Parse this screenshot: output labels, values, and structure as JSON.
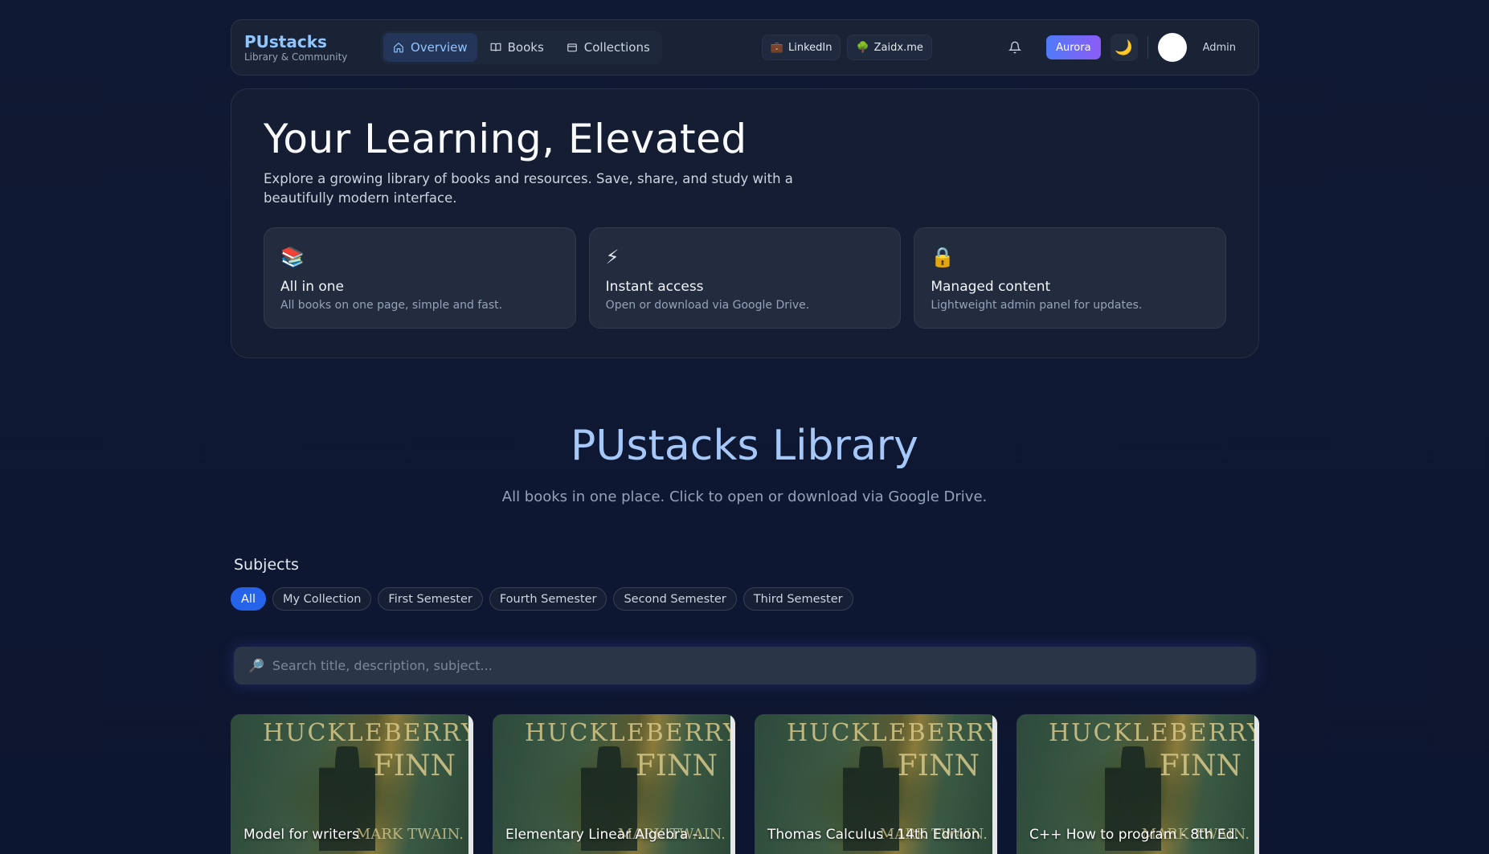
{
  "nav": {
    "brand": "PUstacks",
    "brand_sub": "Library & Community",
    "tabs": [
      {
        "label": "Overview",
        "icon": "home-icon"
      },
      {
        "label": "Books",
        "icon": "book-open-icon"
      },
      {
        "label": "Collections",
        "icon": "archive-icon"
      }
    ],
    "links": [
      {
        "label": "LinkedIn",
        "emoji": "💼"
      },
      {
        "label": "Zaidx.me",
        "emoji": "🌳"
      }
    ],
    "aurora_label": "Aurora",
    "theme_emoji": "🌙",
    "admin_label": "Admin"
  },
  "hero": {
    "title": "Your Learning, Elevated",
    "subtitle": "Explore a growing library of books and resources. Save, share, and study with a beautifully modern interface.",
    "features": [
      {
        "emoji": "📚",
        "title": "All in one",
        "desc": "All books on one page, simple and fast."
      },
      {
        "emoji": "⚡",
        "title": "Instant access",
        "desc": "Open or download via Google Drive."
      },
      {
        "emoji": "🔒",
        "title": "Managed content",
        "desc": "Lightweight admin panel for updates."
      }
    ]
  },
  "library": {
    "title": "PUstacks Library",
    "subtitle": "All books in one place. Click to open or download via Google Drive."
  },
  "subjects": {
    "label": "Subjects",
    "chips": [
      "All",
      "My Collection",
      "First Semester",
      "Fourth Semester",
      "Second Semester",
      "Third Semester"
    ],
    "active": "All"
  },
  "search": {
    "placeholder": "Search title, description, subject..."
  },
  "cover_text": {
    "title": "HUCKLEBERRY",
    "finn": "FINN",
    "author": "MARK TWAIN."
  },
  "books": [
    {
      "title": "Model for writers"
    },
    {
      "title": "Elementary Linear Algebra -..."
    },
    {
      "title": "Thomas Calculus - 14th Edition"
    },
    {
      "title": "C++ How to program - 8th Ed."
    }
  ],
  "colors": {
    "accent": "#2563eb",
    "brand": "#93c5fd",
    "background": "#0f172a"
  }
}
